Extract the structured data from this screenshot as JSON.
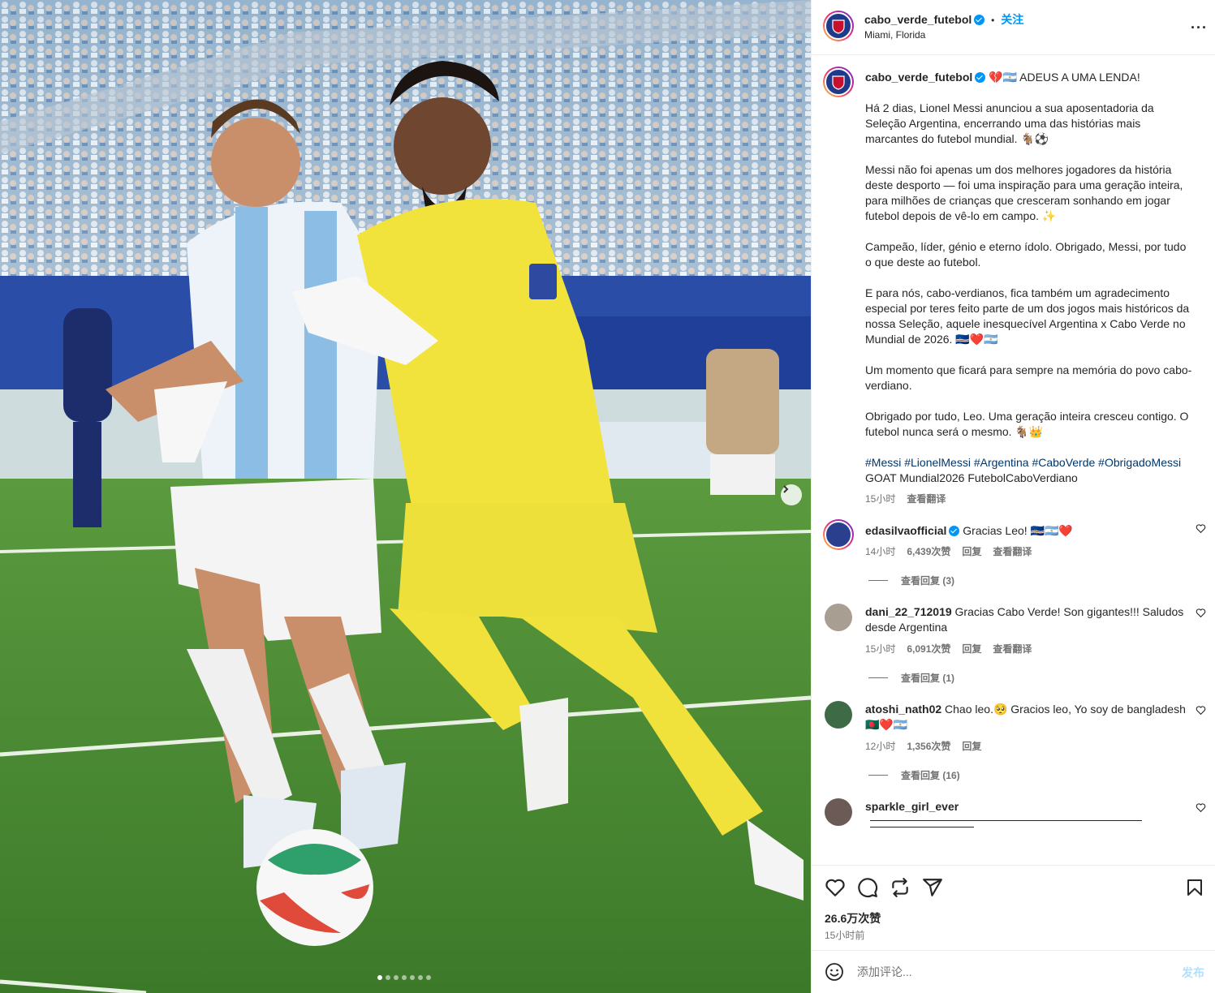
{
  "header": {
    "username": "cabo_verde_futebol",
    "separator": "•",
    "follow_label": "关注",
    "location": "Miami, Florida",
    "more_label": "···"
  },
  "caption": {
    "username": "cabo_verde_futebol",
    "headline": "💔🇦🇷 ADEUS A UMA LENDA!",
    "paragraphs": [
      "Há 2 dias, Lionel Messi anunciou a sua aposentadoria da Seleção Argentina, encerrando uma das histórias mais marcantes do futebol mundial. 🐐⚽",
      "Messi não foi apenas um dos melhores jogadores da história deste desporto — foi uma inspiração para uma geração inteira, para milhões de crianças que cresceram sonhando em jogar futebol depois de vê-lo em campo. ✨",
      "Campeão, líder, génio e eterno ídolo. Obrigado, Messi, por tudo o que deste ao futebol.",
      "E para nós, cabo-verdianos, fica também um agradecimento especial por teres feito parte de um dos jogos mais históricos da nossa Seleção, aquele inesquecível Argentina x Cabo Verde no Mundial de 2026. 🇨🇻❤️🇦🇷",
      "Um momento que ficará para sempre na memória do povo cabo-verdiano.",
      "Obrigado por tudo, Leo. Uma geração inteira cresceu contigo. O futebol nunca será o mesmo. 🐐👑"
    ],
    "hashtags": "#Messi #LionelMessi #Argentina #CaboVerde #ObrigadoMessi",
    "hashtags_line2": "GOAT Mundial2026 FutebolCaboVerdiano",
    "time": "15小时",
    "translate": "查看翻译"
  },
  "comments": [
    {
      "username": "edasilvaofficial",
      "text": "Gracias Leo! 🇨🇻🇦🇷❤️",
      "time": "14小时",
      "likes": "6,439次赞",
      "reply": "回复",
      "translate": "查看翻译",
      "view_replies": "查看回复 (3)"
    },
    {
      "username": "dani_22_712019",
      "text": "Gracias Cabo Verde! Son gigantes!!! Saludos desde Argentina",
      "time": "15小时",
      "likes": "6,091次赞",
      "reply": "回复",
      "translate": "查看翻译",
      "view_replies": "查看回复 (1)"
    },
    {
      "username": "atoshi_nath02",
      "text": "Chao leo.🥺  Gracios leo, Yo soy de bangladesh 🇧🇩❤️🇦🇷",
      "time": "12小时",
      "likes": "1,356次赞",
      "reply": "回复",
      "view_replies": "查看回复 (16)"
    },
    {
      "username": "sparkle_girl_ever"
    }
  ],
  "actions": {
    "likes": "26.6万次赞",
    "time_ago": "15小时前"
  },
  "add_comment": {
    "placeholder": "添加评论...",
    "post_label": "发布"
  },
  "colors": {
    "link": "#0095f6",
    "hashtag": "#00376b",
    "muted": "#737373",
    "divider": "#efefef"
  },
  "carousel": {
    "count": 7,
    "active_index": 0
  }
}
